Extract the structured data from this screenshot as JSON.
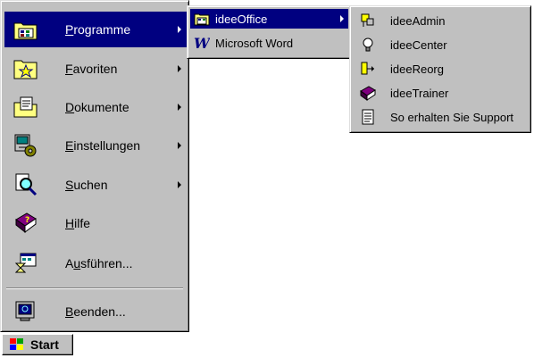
{
  "start_menu": {
    "items": [
      {
        "label": "Programme",
        "accel": "P",
        "rest": "rogramme",
        "icon": "programs-folder-icon"
      },
      {
        "label": "Favoriten",
        "accel": "F",
        "rest": "avoriten",
        "icon": "favorites-folder-icon"
      },
      {
        "label": "Dokumente",
        "accel": "D",
        "rest": "okumente",
        "icon": "documents-folder-icon"
      },
      {
        "label": "Einstellungen",
        "accel": "E",
        "rest": "instellungen",
        "icon": "settings-icon"
      },
      {
        "label": "Suchen",
        "accel": "S",
        "rest": "uchen",
        "icon": "search-icon"
      },
      {
        "label": "Hilfe",
        "accel": "H",
        "rest": "ilfe",
        "icon": "help-book-icon"
      },
      {
        "label": "Ausführen...",
        "pre": "A",
        "accel": "u",
        "rest": "sführen...",
        "icon": "run-icon"
      },
      {
        "label": "Beenden...",
        "accel": "B",
        "rest": "eenden...",
        "icon": "shutdown-icon"
      }
    ]
  },
  "programs_menu": {
    "items": [
      {
        "label": "ideeOffice",
        "icon": "program-group-icon"
      },
      {
        "label": "Microsoft Word",
        "icon": "word-icon"
      }
    ]
  },
  "ideeoffice_menu": {
    "items": [
      {
        "label": "ideeAdmin",
        "icon": "admin-icon"
      },
      {
        "label": "ideeCenter",
        "icon": "lightbulb-icon"
      },
      {
        "label": "ideeReorg",
        "icon": "reorg-icon"
      },
      {
        "label": "ideeTrainer",
        "icon": "trainer-book-icon"
      },
      {
        "label": "So erhalten Sie Support",
        "icon": "document-icon"
      }
    ]
  },
  "taskbar": {
    "start_label": "Start"
  },
  "colors": {
    "menu_bg": "#c0c0c0",
    "highlight": "#000080",
    "highlight_text": "#ffffff"
  }
}
